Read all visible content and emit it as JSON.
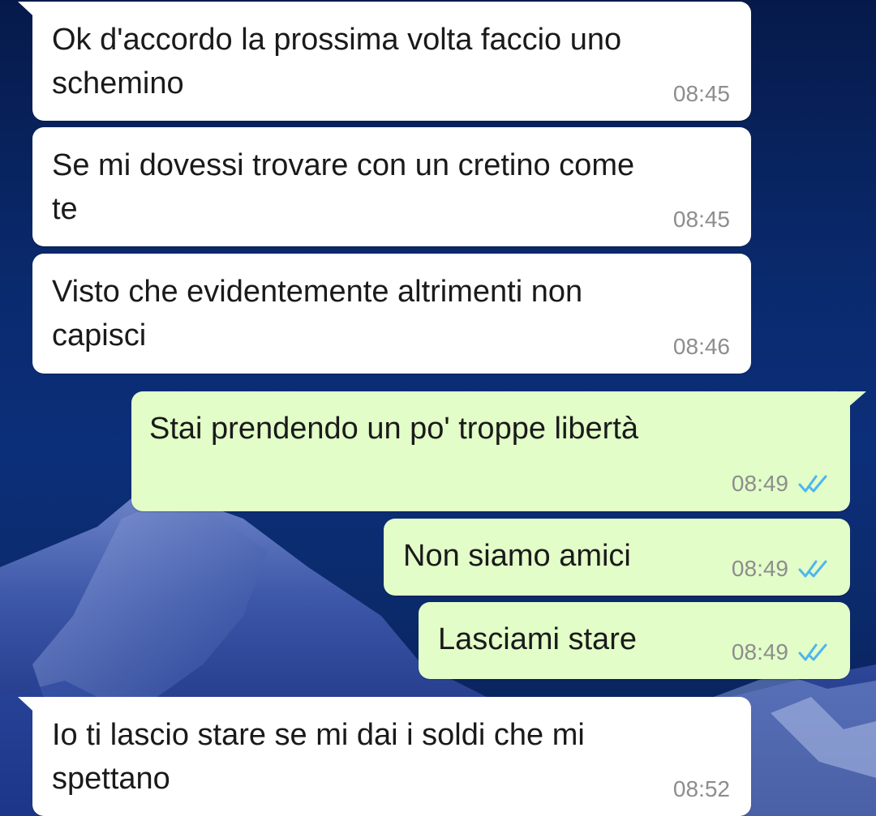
{
  "messages": [
    {
      "direction": "incoming",
      "line1": "Ok d'accordo la prossima volta faccio uno",
      "line2": "schemino",
      "time": "08:45"
    },
    {
      "direction": "incoming",
      "line1": "Se mi dovessi trovare con un cretino come",
      "line2": "te",
      "time": "08:45"
    },
    {
      "direction": "incoming",
      "line1": "Visto che evidentemente altrimenti non",
      "line2": "capisci",
      "time": "08:46"
    },
    {
      "direction": "outgoing",
      "line1": "Stai prendendo un po' troppe libertà",
      "time": "08:49",
      "status_icon": "double-check-read-icon"
    },
    {
      "direction": "outgoing",
      "line1": "Non siamo amici",
      "time": "08:49",
      "status_icon": "double-check-read-icon"
    },
    {
      "direction": "outgoing",
      "line1": "Lasciami stare",
      "time": "08:49",
      "status_icon": "double-check-read-icon"
    },
    {
      "direction": "incoming",
      "line1": "Io ti lascio stare se mi dai i soldi che mi",
      "line2": "spettano",
      "time": "08:52"
    }
  ],
  "colors": {
    "incoming_bubble": "#ffffff",
    "outgoing_bubble": "#e2fdc8",
    "read_ticks": "#4fb6ec",
    "timestamp": "#8d8d8d"
  }
}
